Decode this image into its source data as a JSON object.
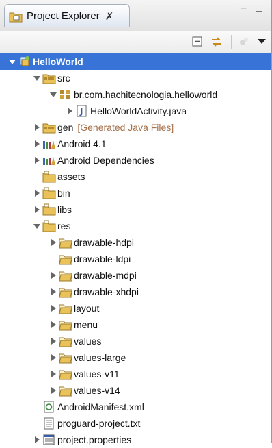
{
  "view": {
    "title": "Project Explorer",
    "close_glyph": "✗"
  },
  "window_buttons": {
    "minimize": "−",
    "maximize": "□"
  },
  "toolbar": {
    "collapse_all": "collapse-all-icon",
    "link_with_editor": "link-with-editor-icon",
    "view_menu_icon": "view-menu-icon",
    "dropdown_icon": "chevron-down-icon"
  },
  "colors": {
    "selection": "#3874d8",
    "decoration": "#a5704a",
    "folder": "#e9c35a",
    "package": "#b58a2f"
  },
  "tree": {
    "root": {
      "label": "HelloWorld",
      "expanded": true,
      "selected": true,
      "icon": "android-project-icon"
    },
    "src": {
      "label": "src",
      "expanded": true,
      "icon": "source-folder-icon"
    },
    "package": {
      "label": "br.com.hachitecnologia.helloworld",
      "expanded": true,
      "icon": "package-icon"
    },
    "activity": {
      "label": "HelloWorldActivity.java",
      "expanded": false,
      "icon": "java-file-icon"
    },
    "gen": {
      "label": "gen",
      "decoration": "[Generated Java Files]",
      "expanded": false,
      "icon": "source-folder-icon"
    },
    "android41": {
      "label": "Android 4.1",
      "expanded": false,
      "icon": "library-icon"
    },
    "android_deps": {
      "label": "Android Dependencies",
      "expanded": false,
      "icon": "library-icon"
    },
    "assets": {
      "label": "assets",
      "icon": "folder-icon"
    },
    "bin": {
      "label": "bin",
      "expanded": false,
      "icon": "folder-icon"
    },
    "libs": {
      "label": "libs",
      "expanded": false,
      "icon": "folder-icon"
    },
    "res": {
      "label": "res",
      "expanded": true,
      "icon": "folder-icon"
    },
    "res_items": [
      {
        "label": "drawable-hdpi",
        "expandable": true
      },
      {
        "label": "drawable-ldpi",
        "expandable": false
      },
      {
        "label": "drawable-mdpi",
        "expandable": true
      },
      {
        "label": "drawable-xhdpi",
        "expandable": true
      },
      {
        "label": "layout",
        "expandable": true
      },
      {
        "label": "menu",
        "expandable": true
      },
      {
        "label": "values",
        "expandable": true
      },
      {
        "label": "values-large",
        "expandable": true
      },
      {
        "label": "values-v11",
        "expandable": true
      },
      {
        "label": "values-v14",
        "expandable": true
      }
    ],
    "manifest": {
      "label": "AndroidManifest.xml",
      "icon": "xml-file-icon"
    },
    "proguard": {
      "label": "proguard-project.txt",
      "icon": "text-file-icon"
    },
    "properties": {
      "label": "project.properties",
      "expanded": false,
      "icon": "properties-file-icon"
    }
  }
}
